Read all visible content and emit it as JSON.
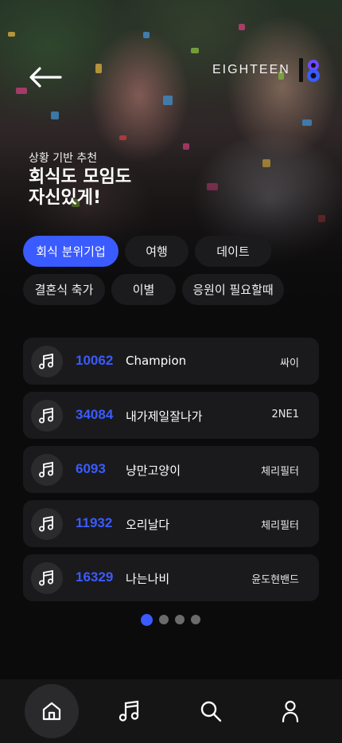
{
  "header": {
    "back_label": "back",
    "brand_name": "EIGHTEEN",
    "brand_logo": "18"
  },
  "hero": {
    "subtitle": "상황 기반 추천",
    "headline_line1": "회식도 모임도",
    "headline_line2": "자신있게!"
  },
  "chips": [
    {
      "label": "회식 분위기업",
      "active": true
    },
    {
      "label": "여행",
      "active": false
    },
    {
      "label": "데이트",
      "active": false
    },
    {
      "label": "결혼식 축가",
      "active": false
    },
    {
      "label": "이별",
      "active": false
    },
    {
      "label": "응원이 필요할때",
      "active": false
    }
  ],
  "songs": [
    {
      "number": "10062",
      "title": "Champion",
      "artist": "싸이"
    },
    {
      "number": "34084",
      "title": "내가제일잘나가",
      "artist": "2NE1"
    },
    {
      "number": "6093",
      "title": "냥만고양이",
      "artist": "체리필터"
    },
    {
      "number": "11932",
      "title": "오리날다",
      "artist": "체리필터"
    },
    {
      "number": "16329",
      "title": "나는나비",
      "artist": "윤도현밴드"
    }
  ],
  "pagination": {
    "total": 4,
    "current": 1
  },
  "tabbar": {
    "items": [
      {
        "icon": "home-icon",
        "active": true
      },
      {
        "icon": "music-note-icon",
        "active": false
      },
      {
        "icon": "search-icon",
        "active": false
      },
      {
        "icon": "user-icon",
        "active": false
      }
    ]
  },
  "colors": {
    "accent": "#3a5bff",
    "background": "#0b0b0c",
    "card": "#1a1a1c"
  }
}
